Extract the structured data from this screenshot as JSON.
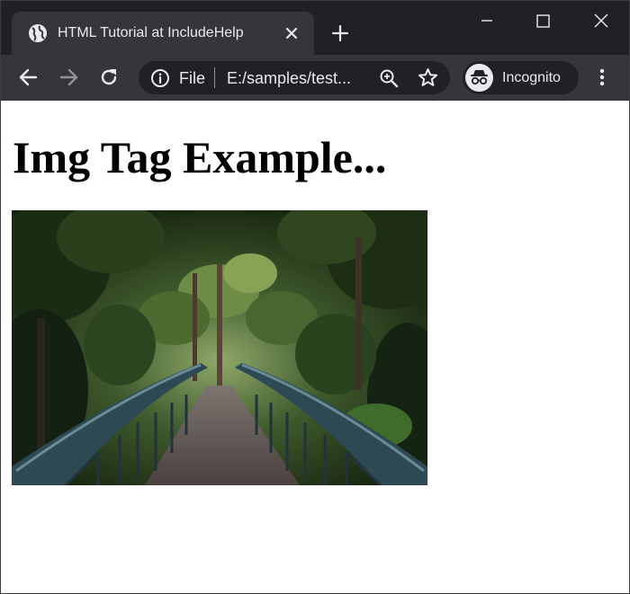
{
  "browser": {
    "tab": {
      "title": "HTML Tutorial at IncludeHelp"
    },
    "address_bar": {
      "scheme_label": "File",
      "url": "E:/samples/test..."
    },
    "profile": {
      "label": "Incognito"
    },
    "icons": {
      "favicon": "globe-icon",
      "tab_close": "close-icon",
      "new_tab": "plus-icon",
      "minimize": "minimize-icon",
      "maximize": "maximize-icon",
      "window_close": "close-icon",
      "back": "back-arrow-icon",
      "forward": "forward-arrow-icon",
      "reload": "reload-icon",
      "site_info": "info-icon",
      "zoom": "zoom-in-icon",
      "bookmark": "star-icon",
      "incognito": "incognito-icon",
      "menu": "kebab-menu-icon"
    },
    "colors": {
      "frame": "#202124",
      "toolbar": "#35363a",
      "text": "#e8eaed",
      "disabled": "#8f9399"
    }
  },
  "page": {
    "heading": "Img Tag Example...",
    "image": {
      "description_icon": "photo-forest-bridge"
    }
  }
}
